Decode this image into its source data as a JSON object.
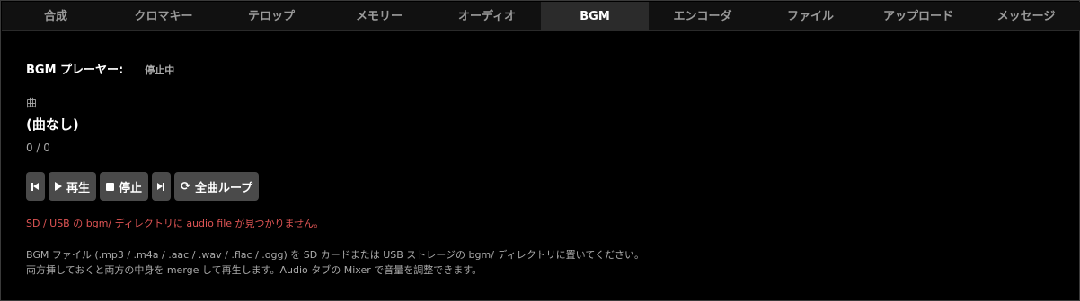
{
  "tabs": [
    {
      "label": "合成",
      "active": false
    },
    {
      "label": "クロマキー",
      "active": false
    },
    {
      "label": "テロップ",
      "active": false
    },
    {
      "label": "メモリー",
      "active": false
    },
    {
      "label": "オーディオ",
      "active": false
    },
    {
      "label": "BGM",
      "active": true
    },
    {
      "label": "エンコーダ",
      "active": false
    },
    {
      "label": "ファイル",
      "active": false
    },
    {
      "label": "アップロード",
      "active": false
    },
    {
      "label": "メッセージ",
      "active": false
    }
  ],
  "player": {
    "label": "BGM プレーヤー:",
    "status": "停止中",
    "track_label": "曲",
    "track_name": "(曲なし)",
    "position": "0 / 0"
  },
  "controls": {
    "prev_icon": "skip-previous-icon",
    "play_label": "再生",
    "stop_label": "停止",
    "next_icon": "skip-next-icon",
    "loop_label": "全曲ループ",
    "loop_glyph": "⟳"
  },
  "messages": {
    "error": "SD / USB の bgm/ ディレクトリに audio file が見つかりません。",
    "help_line1": "BGM ファイル (.mp3 / .m4a / .aac / .wav / .flac / .ogg) を SD カードまたは USB ストレージの bgm/ ディレクトリに置いてください。",
    "help_line2": "両方挿しておくと両方の中身を merge して再生します。Audio タブの Mixer で音量を調整できます。"
  },
  "colors": {
    "background": "#000000",
    "tab_bar": "#111111",
    "tab_active": "#2b2b2b",
    "button": "#4a4a4a",
    "error": "#e05555"
  }
}
